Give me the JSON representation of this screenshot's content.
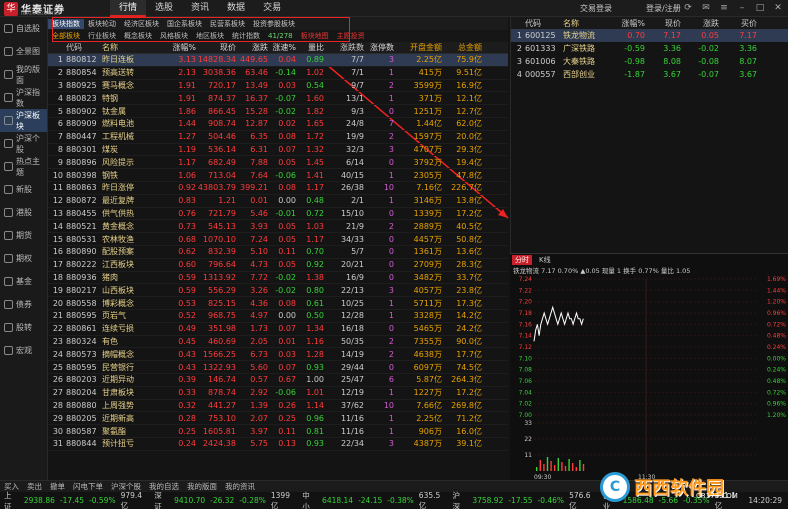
{
  "app": {
    "logo_text": "华泰证券",
    "logo_sub": "HUATAI SECURITIES",
    "trade_login": "交易登录",
    "user_login": "登录/注册"
  },
  "menu": [
    "行情",
    "选股",
    "资讯",
    "数据",
    "交易"
  ],
  "leftnav": [
    "自选股",
    "全景图",
    "我的版面",
    "沪深指数",
    "沪深板块",
    "沪深个股",
    "热点主题",
    "新股",
    "港股",
    "期货",
    "期权",
    "基金",
    "债券",
    "股转",
    "宏观"
  ],
  "subtabs1": [
    "板块指数",
    "板块轮动",
    "经济区板块",
    "国企系板块",
    "民营系板块",
    "投资参股板块"
  ],
  "subtabs2": {
    "items": [
      "全部板块",
      "行业板块",
      "概念板块",
      "风格板块",
      "地区板块",
      "统计指数"
    ],
    "count": "41/278",
    "map": "板块地图",
    "theme": "主题投资"
  },
  "table": {
    "headers": [
      "",
      "代码",
      "名称",
      "涨幅%",
      "现价",
      "涨跌",
      "涨速%",
      "量比",
      "涨跌数",
      "涨停数",
      "开盘金额",
      "总金额"
    ],
    "rows": [
      [
        "1",
        "880812",
        "昨日连板",
        "3.13",
        "14828.34",
        "449.65",
        "0.04",
        "0.89",
        "7/7",
        "3",
        "2.25亿",
        "75.9亿"
      ],
      [
        "2",
        "880854",
        "预高送转",
        "2.13",
        "3038.36",
        "63.46",
        "-0.14",
        "1.02",
        "7/1",
        "1",
        "415万",
        "9.51亿"
      ],
      [
        "3",
        "880925",
        "赛马概念",
        "1.91",
        "720.17",
        "13.49",
        "0.03",
        "0.54",
        "9/7",
        "2",
        "3599万",
        "16.9亿"
      ],
      [
        "4",
        "880823",
        "特钢",
        "1.91",
        "874.37",
        "16.37",
        "-0.07",
        "1.60",
        "13/1",
        "1",
        "371万",
        "12.1亿"
      ],
      [
        "5",
        "880902",
        "钛金属",
        "1.86",
        "866.45",
        "15.28",
        "-0.02",
        "1.82",
        "9/3",
        "0",
        "1251万",
        "12.7亿"
      ],
      [
        "6",
        "880909",
        "燃料电池",
        "1.44",
        "908.74",
        "12.87",
        "0.02",
        "1.65",
        "24/8",
        "7",
        "1.44亿",
        "62.0亿"
      ],
      [
        "7",
        "880447",
        "工程机械",
        "1.27",
        "504.46",
        "6.35",
        "0.08",
        "1.72",
        "19/9",
        "2",
        "1597万",
        "20.0亿"
      ],
      [
        "8",
        "880301",
        "煤炭",
        "1.19",
        "536.14",
        "6.31",
        "0.07",
        "1.32",
        "32/3",
        "3",
        "4707万",
        "29.3亿"
      ],
      [
        "9",
        "880896",
        "风险提示",
        "1.17",
        "682.49",
        "7.88",
        "0.05",
        "1.45",
        "6/14",
        "0",
        "3792万",
        "19.4亿"
      ],
      [
        "10",
        "880398",
        "钢铁",
        "1.06",
        "713.04",
        "7.64",
        "-0.06",
        "1.41",
        "40/15",
        "1",
        "2305万",
        "47.8亿"
      ],
      [
        "11",
        "880863",
        "昨日涨停",
        "0.92",
        "43803.79",
        "399.21",
        "0.08",
        "1.17",
        "26/38",
        "10",
        "7.16亿",
        "226.7亿"
      ],
      [
        "12",
        "880872",
        "最近复牌",
        "0.83",
        "1.21",
        "0.01",
        "0.00",
        "0.48",
        "2/1",
        "1",
        "3146万",
        "13.8亿"
      ],
      [
        "13",
        "880455",
        "供气供热",
        "0.76",
        "721.79",
        "5.46",
        "-0.01",
        "0.72",
        "15/10",
        "0",
        "1339万",
        "17.2亿"
      ],
      [
        "14",
        "880521",
        "黄金概念",
        "0.73",
        "545.13",
        "3.93",
        "0.05",
        "1.03",
        "21/9",
        "2",
        "2889万",
        "40.5亿"
      ],
      [
        "15",
        "880531",
        "农林牧渔",
        "0.68",
        "1070.10",
        "7.24",
        "0.05",
        "1.17",
        "34/33",
        "0",
        "4457万",
        "50.8亿"
      ],
      [
        "16",
        "880890",
        "配股预案",
        "0.62",
        "832.39",
        "5.10",
        "0.11",
        "0.70",
        "5/7",
        "0",
        "1361万",
        "13.6亿"
      ],
      [
        "17",
        "880222",
        "江西板块",
        "0.60",
        "796.64",
        "4.73",
        "0.05",
        "0.92",
        "20/21",
        "0",
        "2709万",
        "28.3亿"
      ],
      [
        "18",
        "880936",
        "猪肉",
        "0.59",
        "1313.92",
        "7.72",
        "-0.02",
        "1.38",
        "16/9",
        "0",
        "3482万",
        "33.7亿"
      ],
      [
        "19",
        "880217",
        "山西板块",
        "0.59",
        "556.29",
        "3.26",
        "-0.02",
        "0.80",
        "22/13",
        "3",
        "4057万",
        "23.8亿"
      ],
      [
        "20",
        "880558",
        "博彩概念",
        "0.53",
        "825.15",
        "4.36",
        "0.08",
        "0.61",
        "10/25",
        "1",
        "5711万",
        "17.3亿"
      ],
      [
        "21",
        "880595",
        "页岩气",
        "0.52",
        "968.75",
        "4.97",
        "0.00",
        "0.50",
        "12/28",
        "1",
        "3328万",
        "14.2亿"
      ],
      [
        "22",
        "880861",
        "连续亏损",
        "0.49",
        "351.98",
        "1.73",
        "0.07",
        "1.34",
        "16/18",
        "0",
        "5465万",
        "24.2亿"
      ],
      [
        "23",
        "880324",
        "有色",
        "0.45",
        "460.69",
        "2.05",
        "0.01",
        "1.16",
        "50/35",
        "2",
        "7355万",
        "90.0亿"
      ],
      [
        "24",
        "880573",
        "摘帽概念",
        "0.43",
        "1566.25",
        "6.73",
        "0.03",
        "1.28",
        "14/19",
        "2",
        "4638万",
        "17.7亿"
      ],
      [
        "25",
        "880595",
        "民营银行",
        "0.43",
        "1322.93",
        "5.60",
        "0.07",
        "0.93",
        "29/44",
        "0",
        "6097万",
        "74.5亿"
      ],
      [
        "26",
        "880203",
        "近期异动",
        "0.39",
        "146.74",
        "0.57",
        "0.67",
        "1.00",
        "25/47",
        "6",
        "5.87亿",
        "264.3亿"
      ],
      [
        "27",
        "880204",
        "甘肃板块",
        "0.33",
        "878.74",
        "2.92",
        "-0.06",
        "1.01",
        "12/19",
        "1",
        "1227万",
        "17.2亿"
      ],
      [
        "28",
        "880880",
        "上周强势",
        "0.32",
        "441.27",
        "1.39",
        "0.26",
        "1.14",
        "37/62",
        "10",
        "7.66亿",
        "269.8亿"
      ],
      [
        "29",
        "880205",
        "近期新高",
        "0.28",
        "753.10",
        "2.07",
        "0.25",
        "0.96",
        "11/16",
        "1",
        "2.25亿",
        "71.2亿"
      ],
      [
        "30",
        "880587",
        "聚氨酯",
        "0.25",
        "1605.81",
        "3.97",
        "0.11",
        "0.81",
        "11/16",
        "1",
        "906万",
        "16.0亿"
      ],
      [
        "31",
        "880844",
        "预计扭亏",
        "0.24",
        "2424.38",
        "5.75",
        "0.13",
        "0.93",
        "22/34",
        "3",
        "4387万",
        "39.1亿"
      ]
    ]
  },
  "rightpane": {
    "headers": [
      "",
      "代码",
      "名称",
      "涨幅%",
      "现价",
      "涨跌",
      "买价"
    ],
    "rows": [
      [
        "1",
        "600125",
        "铁龙物流",
        "0.70",
        "7.17",
        "0.05",
        "7.17"
      ],
      [
        "2",
        "601333",
        "广深铁路",
        "-0.59",
        "3.36",
        "-0.02",
        "3.36"
      ],
      [
        "3",
        "601006",
        "大秦铁路",
        "-0.98",
        "8.08",
        "-0.08",
        "8.07"
      ],
      [
        "4",
        "000557",
        "西部创业",
        "-1.87",
        "3.67",
        "-0.07",
        "3.67"
      ]
    ]
  },
  "chart": {
    "tabs": [
      "分时",
      "K线"
    ],
    "info": "铁龙物流  7.17  0.70%  ▲0.05  现量 1  换手 0.77%  量比 1.05",
    "left_labels": [
      "7.24",
      "7.22",
      "7.20",
      "7.18",
      "7.16",
      "7.14",
      "7.12",
      "7.10",
      "7.08",
      "7.06",
      "7.04",
      "7.02",
      "7.00"
    ],
    "right_labels": [
      "1.69%",
      "1.44%",
      "1.20%",
      "0.96%",
      "0.72%",
      "0.48%",
      "0.24%",
      "0.00%",
      "0.24%",
      "0.48%",
      "0.72%",
      "0.96%",
      "1.20%"
    ],
    "vol_labels": [
      "33",
      "22",
      "11"
    ],
    "time_start": "09:30",
    "time_mid": "11:30"
  },
  "chart_data": {
    "type": "line",
    "title": "铁龙物流",
    "x": [
      0,
      1,
      2,
      3,
      4,
      5,
      6,
      7,
      8,
      9,
      10,
      11,
      12,
      13,
      14,
      15,
      16,
      17,
      18,
      19,
      20,
      21,
      22,
      23,
      24,
      25,
      26,
      27,
      28,
      29
    ],
    "series": [
      {
        "values": [
          7.13,
          7.15,
          7.16,
          7.14,
          7.16,
          7.17,
          7.18,
          7.17,
          7.16,
          7.17,
          7.18,
          7.19,
          7.18,
          7.17,
          7.16,
          7.17,
          7.18,
          7.17,
          7.16,
          7.17,
          7.18,
          7.17,
          7.17,
          7.16,
          7.17,
          7.18,
          7.17,
          7.17,
          7.16,
          7.17
        ]
      }
    ],
    "ylim": [
      7.0,
      7.24
    ],
    "grid": true
  },
  "bottombar": [
    "买入",
    "卖出",
    "撤单",
    "闪电下单",
    "沪深个股",
    "我的自选",
    "我的版面",
    "我的资讯"
  ],
  "status": {
    "sh": "上证",
    "sh_val": "2938.86",
    "sh_chg": "-17.45",
    "sh_pct": "-0.59%",
    "sh_amt": "979.4亿",
    "sz": "深证",
    "sz_val": "9410.70",
    "sz_chg": "-26.32",
    "sz_pct": "-0.28%",
    "sz_amt": "1399亿",
    "zx": "中小",
    "zx_val": "6418.14",
    "zx_chg": "-24.15",
    "zx_pct": "-0.38%",
    "zx_amt": "635.5亿",
    "hs": "沪深",
    "hs_val": "3758.92",
    "hs_chg": "-17.55",
    "hs_pct": "-0.46%",
    "hs_amt": "576.6亿",
    "cy": "创业",
    "cy_val": "1586.48",
    "cy_chg": "-5.66",
    "cy_pct": "-0.35%",
    "cy_amt": "431.1亿",
    "time": "14:20:29"
  },
  "watermark": {
    "text": "西西软件园",
    "sub": "CR173.COM"
  }
}
